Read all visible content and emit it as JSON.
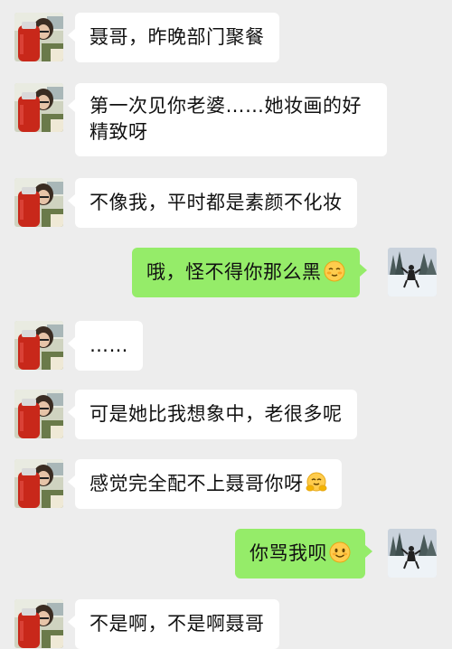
{
  "messages": [
    {
      "side": "left",
      "text": "聂哥，昨晚部门聚餐"
    },
    {
      "side": "left",
      "text": "第一次见你老婆……她妆画的好精致呀"
    },
    {
      "side": "left",
      "text": "不像我，平时都是素颜不化妆"
    },
    {
      "side": "right",
      "text": "哦，怪不得你那么黑",
      "emoji": "blushing-face-icon"
    },
    {
      "side": "left",
      "text": "……"
    },
    {
      "side": "left",
      "text": "可是她比我想象中，老很多呢"
    },
    {
      "side": "left",
      "text": "感觉完全配不上聂哥你呀",
      "emoji": "hugging-face-icon"
    },
    {
      "side": "right",
      "text": "你骂我呗",
      "emoji": "smiling-face-icon"
    },
    {
      "side": "left",
      "text": "不是啊，不是啊聂哥"
    }
  ],
  "avatars": {
    "contact": "contact-avatar",
    "self": "self-avatar"
  },
  "colors": {
    "background": "#ededed",
    "left_bubble": "#ffffff",
    "right_bubble": "#95ec69",
    "text": "#111111"
  }
}
